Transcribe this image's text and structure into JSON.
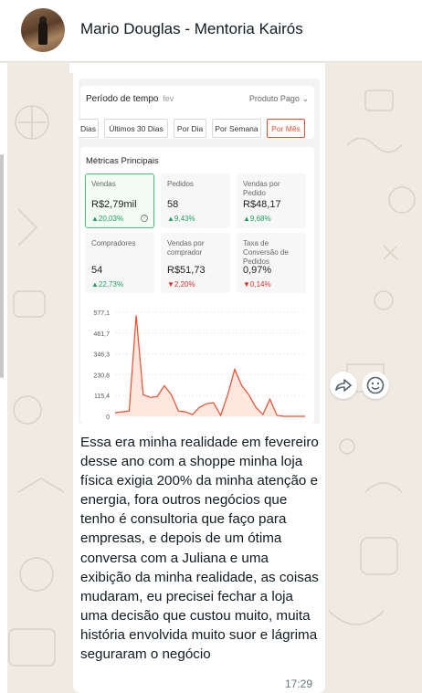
{
  "header": {
    "contact_name": "Mario Douglas - Mentoria Kairós",
    "avatar_icon": "profile-photo"
  },
  "message": {
    "time": "17:29",
    "text": "Essa era minha realidade em fevereiro desse ano com a shoppe minha loja física exigia 200% da minha atenção e energia, fora outros negócios que tenho é consultoria que faço para empresas, e depois de um ótima conversa com a Juliana e uma exibição da minha realidade, as coisas mudaram, eu precisei fechar a loja uma decisão que custou muito, muita história envolvida muito suor e lágrima seguraram o negócio",
    "actions": {
      "forward_icon": "forward-icon",
      "emoji_icon": "emoji-icon"
    }
  },
  "screenshot": {
    "period": {
      "title": "Período de tempo",
      "month": "fev",
      "product_filter": "Produto Pago",
      "chips": [
        "Dias",
        "Últimos 30 Dias",
        "Por Dia",
        "Por Semana",
        "Por Mês"
      ],
      "active_chip": "Por Mês"
    },
    "metrics": {
      "title": "Métricas Principais",
      "items": [
        {
          "label": "Vendas",
          "value": "R$2,79mil",
          "change": "▲20,03%",
          "trend": "up"
        },
        {
          "label": "Pedidos",
          "value": "58",
          "change": "▲9,43%",
          "trend": "up"
        },
        {
          "label": "Vendas por Pedido",
          "value": "R$48,17",
          "change": "▲9,68%",
          "trend": "up"
        },
        {
          "label": "Compradores",
          "value": "54",
          "change": "▲22,73%",
          "trend": "up"
        },
        {
          "label": "Vendas por comprador",
          "value": "R$51,73",
          "change": "▼2,20%",
          "trend": "down"
        },
        {
          "label": "Taxa de Conversão de Pedidos",
          "value": "0,97%",
          "change": "▼0,14%",
          "trend": "down"
        }
      ]
    }
  },
  "chart_data": {
    "type": "area",
    "title": "",
    "xlabel": "",
    "ylabel": "",
    "y_ticks": [
      "577,1",
      "461,7",
      "346,3",
      "230,8",
      "115,4",
      "0"
    ],
    "ylim": [
      0,
      577.1
    ],
    "x": [
      1,
      2,
      3,
      4,
      5,
      6,
      7,
      8,
      9,
      10,
      11,
      12,
      13,
      14,
      15,
      16,
      17,
      18,
      19,
      20,
      21,
      22,
      23,
      24,
      25,
      26,
      27,
      28
    ],
    "values": [
      20,
      25,
      30,
      560,
      120,
      105,
      110,
      170,
      120,
      30,
      25,
      10,
      50,
      70,
      75,
      5,
      120,
      260,
      170,
      120,
      50,
      10,
      95,
      5,
      0,
      0,
      0,
      0
    ],
    "series_color": "#ee4d2d",
    "fill_color": "#fde7df",
    "grid": true
  }
}
